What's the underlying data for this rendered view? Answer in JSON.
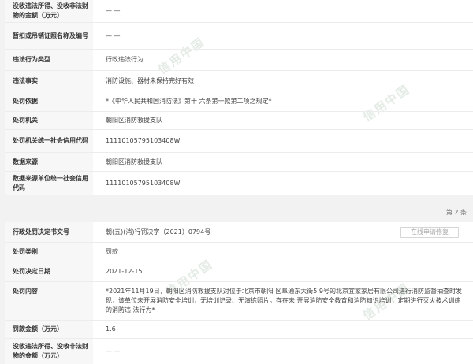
{
  "watermark_text": "信用中国",
  "section1": {
    "rows": [
      {
        "label": "没收违法所得、没收非法财物的金额（万元）",
        "value": "— —"
      },
      {
        "label": "暂扣或吊销证照名称及编号",
        "value": "— —"
      },
      {
        "label": "违法行为类型",
        "value": "行政违法行为"
      },
      {
        "label": "违法事实",
        "value": "消防设施、器材未保持完好有效"
      },
      {
        "label": "处罚依据",
        "value": "*《中华人民共和国消防法》第十 六条第一款第二项之规定*"
      },
      {
        "label": "处罚机关",
        "value": "朝阳区消防救援支队"
      },
      {
        "label": "处罚机关统一社会信用代码",
        "value": "11110105795103408W"
      },
      {
        "label": "数据来源",
        "value": "朝阳区消防救援支队"
      },
      {
        "label": "数据来源单位统一社会信用代码",
        "value": "11110105795103408W"
      }
    ]
  },
  "page_indicator": "第 2 条",
  "section2": {
    "repair_button": "在线申请修复",
    "rows": [
      {
        "label": "行政处罚决定书文号",
        "value": "朝(五)(消)行罚决字（2021）0794号"
      },
      {
        "label": "处罚类别",
        "value": "罚款"
      },
      {
        "label": "处罚决定日期",
        "value": "2021-12-15"
      },
      {
        "label": "处罚内容",
        "value": "*2021年11月19日，朝阳区消防救援支队对位于北京市朝阳 区阜通东大街5 9号的北京宜家家居有限公司进行消防监督抽查时发 现，该单位未开展消防安全培训，无培训记录、无演练照片。存在未 开展消防安全教育和消防知识培训，定期进行灭火技术训练的消防违 法行为*"
      },
      {
        "label": "罚款金额（万元）",
        "value": "1.6"
      },
      {
        "label": "没收违法所得、没收非法财物的金额（万元）",
        "value": "— —"
      }
    ]
  }
}
